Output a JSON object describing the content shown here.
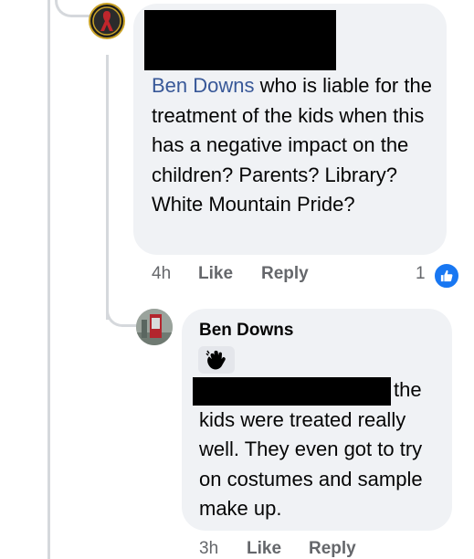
{
  "comment1": {
    "mention": "Ben Downs",
    "text": " who is liable for the treatment of the kids when this has a negative impact on the children? Parents? Library? White Mountain Pride?",
    "time": "4h",
    "like_label": "Like",
    "reply_label": "Reply",
    "reaction_count": "1",
    "reaction_icon": "thumbs-up-icon",
    "avatar_icon": "ribbon-emblem-icon"
  },
  "comment2": {
    "author": "Ben Downs",
    "emoji": "waving-hand-icon",
    "text_first": "the",
    "text_rest": "kids were treated really well. They even got to try on costumes and sample make up.",
    "time": "3h",
    "like_label": "Like",
    "reply_label": "Reply",
    "avatar_icon": "phone-booth-photo-icon"
  },
  "colors": {
    "bubble": "#f0f2f5",
    "mention": "#385898",
    "meta": "#65676b",
    "like_blue": "#1877f2",
    "thread_line": "#d5d8dc"
  }
}
